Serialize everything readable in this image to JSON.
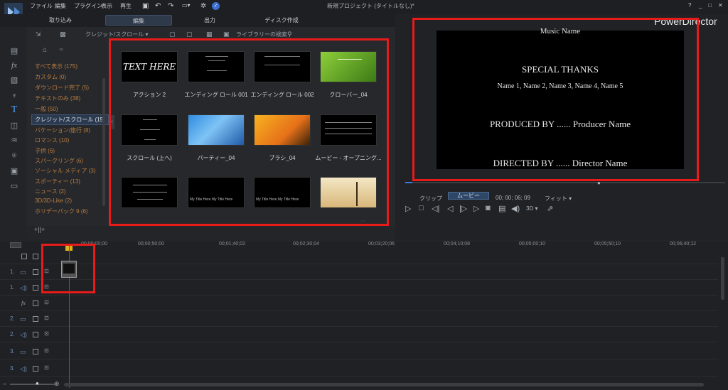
{
  "app": {
    "title": "新規プロジェクト (タイトルなし)*",
    "brand": "PowerDirector"
  },
  "menu": [
    "ファイル",
    "編集",
    "プラグイン",
    "表示",
    "再生"
  ],
  "window_buttons": [
    "?",
    "_",
    "□",
    "✕"
  ],
  "tabs": [
    "取り込み",
    "編集",
    "出力",
    "ディスク作成"
  ],
  "library": {
    "dropdown": "クレジット/スクロール",
    "search_placeholder": "ライブラリーの検索",
    "categories": [
      {
        "label": "すべて表示 (175)",
        "selected": false
      },
      {
        "label": "カスタム (0)",
        "selected": false
      },
      {
        "label": "ダウンロード完了 (5)",
        "selected": false
      },
      {
        "label": "テキストのみ (38)",
        "selected": false
      },
      {
        "label": "一般 (50)",
        "selected": false
      },
      {
        "label": "クレジット/スクロール (15)",
        "selected": true
      },
      {
        "label": "バケーション/旅行 (8)",
        "selected": false
      },
      {
        "label": "ロマンス (10)",
        "selected": false
      },
      {
        "label": "子供 (6)",
        "selected": false
      },
      {
        "label": "スパークリング (6)",
        "selected": false
      },
      {
        "label": "ソーシャル メディア (3)",
        "selected": false
      },
      {
        "label": "スポーティー (13)",
        "selected": false
      },
      {
        "label": "ニュース (2)",
        "selected": false
      },
      {
        "label": "3D/3D-Like (2)",
        "selected": false
      },
      {
        "label": "ホリデーパック 9 (6)",
        "selected": false
      }
    ],
    "thumbnails": [
      {
        "label": "アクション 2",
        "preview_text": "TEXT HERE"
      },
      {
        "label": "エンディング ロール 001",
        "preview_text": ""
      },
      {
        "label": "エンディング ロール 002",
        "preview_text": ""
      },
      {
        "label": "クローバー_04",
        "preview_text": ""
      },
      {
        "label": "スクロール (上へ)",
        "preview_text": ""
      },
      {
        "label": "パーティー_04",
        "preview_text": ""
      },
      {
        "label": "ブラシ_04",
        "preview_text": ""
      },
      {
        "label": "ムービー - オープニング...",
        "preview_text": ""
      },
      {
        "label": "",
        "preview_text": ""
      },
      {
        "label": "",
        "preview_text": "My Title Here My Title Here"
      },
      {
        "label": "",
        "preview_text": "My Title Here My Title Here"
      },
      {
        "label": "",
        "preview_text": ""
      }
    ]
  },
  "preview": {
    "lines": [
      "Music Name",
      "SPECIAL THANKS",
      "Name 1, Name 2, Name 3, Name 4, Name 5",
      "PRODUCED BY ...... Producer Name",
      "DIRECTED BY ...... Director Name"
    ],
    "clip_label": "クリップ",
    "movie_label": "ムービー",
    "timecode": "00; 00; 06; 09",
    "fit_label": "フィット",
    "mode_3d": "3D"
  },
  "timeline": {
    "ruler": [
      "00;00;00;00",
      "00;00;50;00",
      "00;01;40;02",
      "00;02;30;04",
      "00;03;20;06",
      "00;04;10;08",
      "00;05;00;10",
      "00;05;50;10",
      "00;06;40;12"
    ],
    "tracks": [
      {
        "num": "",
        "kind": "master"
      },
      {
        "num": "1.",
        "kind": "video"
      },
      {
        "num": "1.",
        "kind": "audio"
      },
      {
        "num": "fx",
        "kind": "fx"
      },
      {
        "num": "2.",
        "kind": "video"
      },
      {
        "num": "2.",
        "kind": "audio"
      },
      {
        "num": "3.",
        "kind": "video"
      },
      {
        "num": "3.",
        "kind": "audio"
      }
    ]
  }
}
